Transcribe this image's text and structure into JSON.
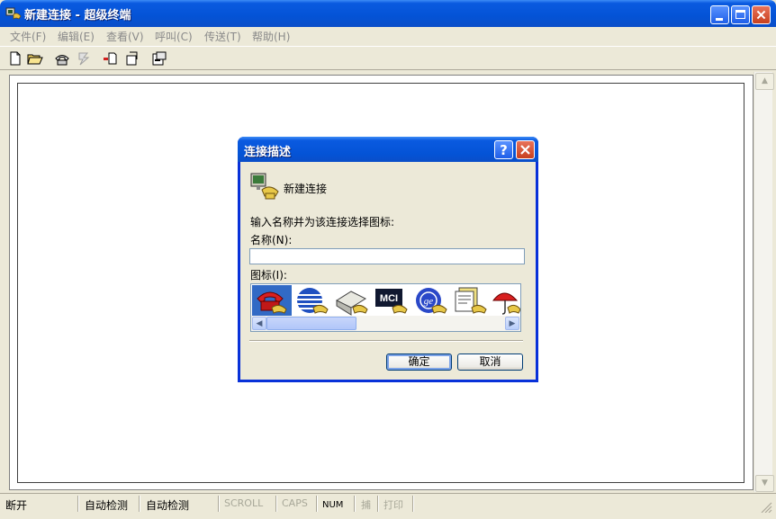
{
  "window": {
    "title": "新建连接 - 超级终端"
  },
  "menu": [
    {
      "id": "file",
      "label": "文件(F)"
    },
    {
      "id": "edit",
      "label": "编辑(E)"
    },
    {
      "id": "view",
      "label": "查看(V)"
    },
    {
      "id": "call",
      "label": "呼叫(C)"
    },
    {
      "id": "transfer",
      "label": "传送(T)"
    },
    {
      "id": "help",
      "label": "帮助(H)"
    }
  ],
  "dialog": {
    "title": "连接描述",
    "connection_name": "新建连接",
    "instruction": "输入名称并为该连接选择图标:",
    "name_label": "名称(N):",
    "name_value": "",
    "icon_label": "图标(I):",
    "icons": [
      "red-phone-icon",
      "globe-stripes-icon",
      "fax-icon",
      "mci-icon",
      "ge-globe-icon",
      "documents-icon",
      "umbrella-icon"
    ],
    "ok_label": "确定",
    "cancel_label": "取消"
  },
  "status": {
    "connection": "断开",
    "detect1": "自动检测",
    "detect2": "自动检测",
    "scroll": "SCROLL",
    "caps": "CAPS",
    "num": "NUM",
    "capture": "捕",
    "print": "打印"
  }
}
